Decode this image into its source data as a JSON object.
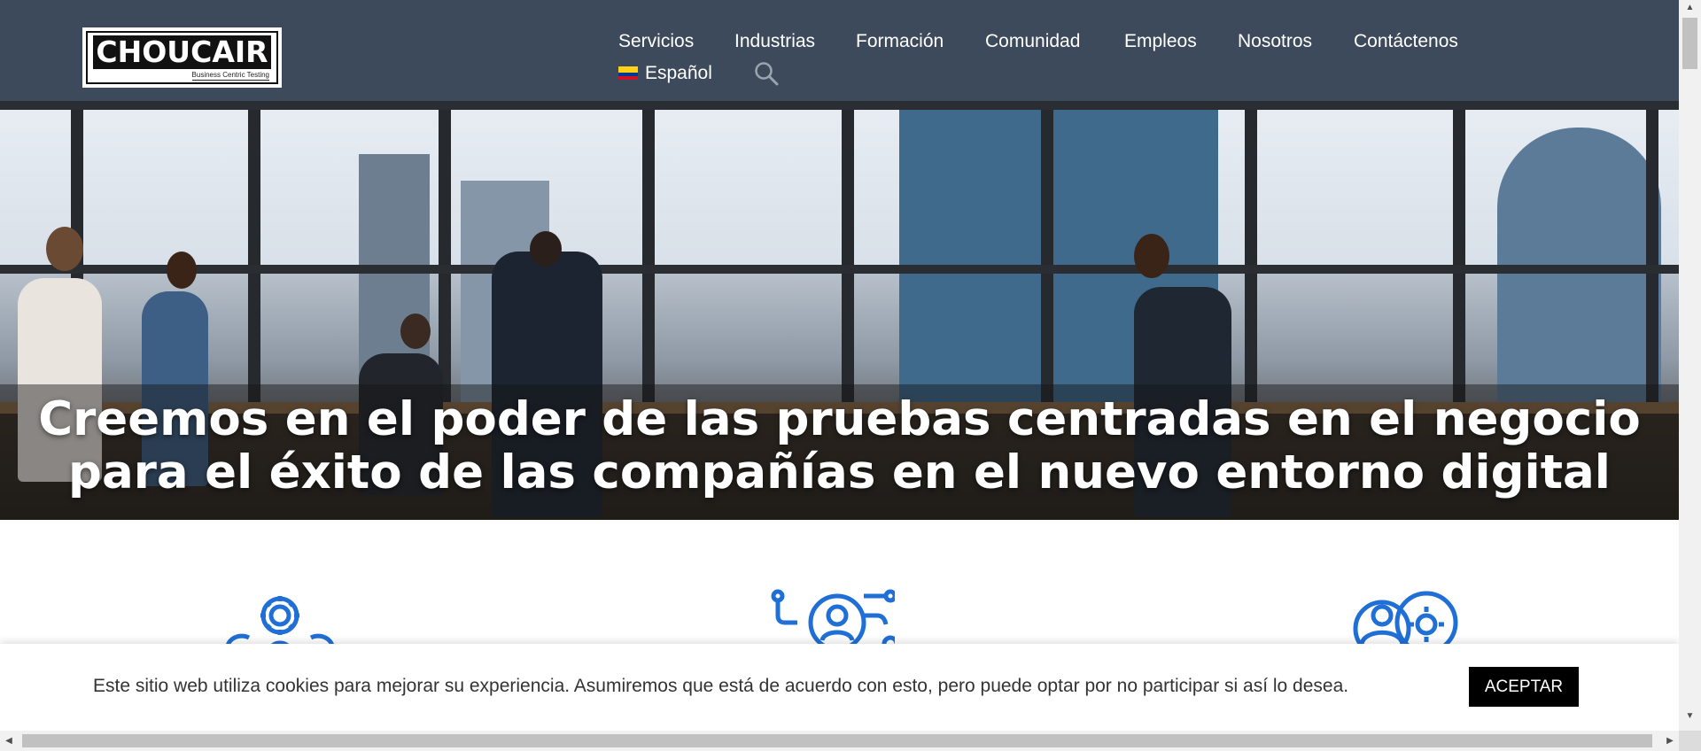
{
  "brand": {
    "name": "CHOUCAIR",
    "tagline": "Business Centric Testing"
  },
  "nav": {
    "items": [
      "Servicios",
      "Industrias",
      "Formación",
      "Comunidad",
      "Empleos",
      "Nosotros",
      "Contáctenos"
    ],
    "language": "Español",
    "language_flag_colors": [
      "#fcd116",
      "#003893",
      "#ce1126"
    ],
    "search_icon": "search-icon"
  },
  "hero": {
    "title_line1": "Creemos en el poder de las pruebas centradas en el negocio",
    "title_line2": "para el éxito de las compañías en el nuevo entorno digital"
  },
  "features": [
    {
      "icon": "gears-team-icon"
    },
    {
      "icon": "user-network-icon"
    },
    {
      "icon": "people-settings-icon"
    }
  ],
  "cookie": {
    "text": "Este sitio web utiliza cookies para mejorar su experiencia. Asumiremos que está de acuerdo con esto, pero puede optar por no participar si así lo desea.",
    "accept_label": "ACEPTAR"
  },
  "colors": {
    "header_bg": "#3d4a5c",
    "accent_blue": "#1f6fd6",
    "accept_bg": "#000000"
  }
}
